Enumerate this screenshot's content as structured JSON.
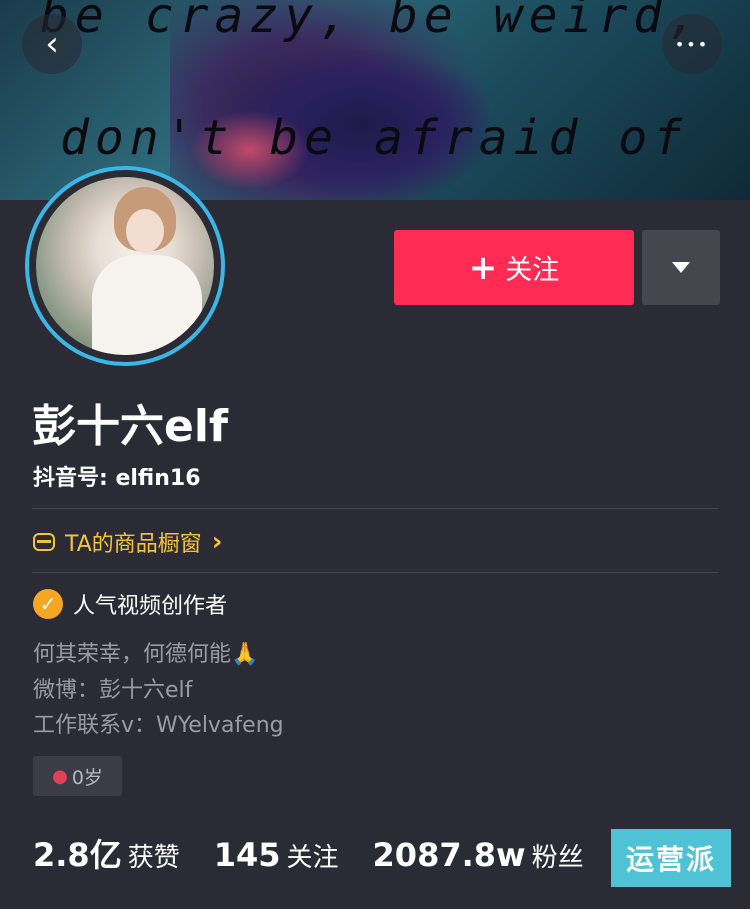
{
  "banner": {
    "line1": "be crazy, be weird,",
    "line2": "don't be afraid of"
  },
  "nav": {
    "back_icon": "back-arrow-icon",
    "back_glyph": "‹",
    "more_icon": "more-dots-icon",
    "more_glyph": "•••"
  },
  "profile": {
    "name": "彭十六elf",
    "douyin_id": "抖音号: elfin16"
  },
  "actions": {
    "follow_plus": "+",
    "follow_label": "关注",
    "dropdown_icon": "caret-down-icon"
  },
  "shop": {
    "label": "TA的商品橱窗",
    "chevron": "›"
  },
  "verification": {
    "label": "人气视频创作者",
    "check": "✓"
  },
  "bio": {
    "line1": "何其荣幸，何德何能🙏",
    "line2": "微博：彭十六elf",
    "line3": "工作联系v：WYelvafeng"
  },
  "tags": {
    "age": "0岁",
    "gender_icon": "female-icon"
  },
  "stats": [
    {
      "value": "2.8亿",
      "label": "获赞"
    },
    {
      "value": "145",
      "label": "关注"
    },
    {
      "value": "2087.8w",
      "label": "粉丝"
    }
  ],
  "watermark": "运营派",
  "colors": {
    "follow_button": "#fe2c55",
    "avatar_ring": "#3cb6e6",
    "shop_link": "#f6c33b",
    "verified_badge": "#f6a623",
    "background": "#2b2b35"
  }
}
